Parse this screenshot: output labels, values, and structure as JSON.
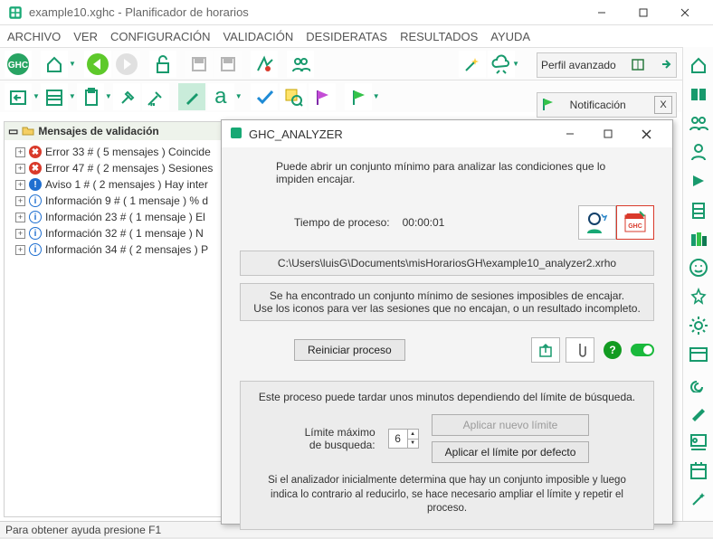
{
  "window": {
    "title": "example10.xghc - Planificador de horarios",
    "status": "Para obtener ayuda presione F1"
  },
  "menu": [
    "ARCHIVO",
    "VER",
    "CONFIGURACIÓN",
    "VALIDACIÓN",
    "DESIDERATAS",
    "RESULTADOS",
    "AYUDA"
  ],
  "profile": {
    "label": "Perfil avanzado"
  },
  "notification": {
    "label": "Notificación",
    "close": "X"
  },
  "tree": {
    "header": "Mensajes de validación",
    "items": [
      {
        "kind": "err",
        "text": "Error 33 # ( 5 mensajes )  Coincide"
      },
      {
        "kind": "err",
        "text": "Error 47 # ( 2 mensajes )  Sesiones"
      },
      {
        "kind": "warn",
        "text": "Aviso 1 # ( 2 mensajes )  Hay inter"
      },
      {
        "kind": "info",
        "text": "Información 9 # ( 1 mensaje )   % d"
      },
      {
        "kind": "info",
        "text": "Información 23 # ( 1 mensaje )   El"
      },
      {
        "kind": "info",
        "text": "Información 32 # ( 1 mensaje )   N"
      },
      {
        "kind": "info",
        "text": "Información 34 # ( 2 mensajes )  P"
      }
    ]
  },
  "dialog": {
    "title": "GHC_ANALYZER",
    "intro": "Puede abrir un conjunto mínimo para analizar las condiciones que lo impiden encajar.",
    "time_label": "Tiempo de proceso:",
    "time_value": "00:00:01",
    "path": "C:\\Users\\luisG\\Documents\\misHorariosGH\\example10_analyzer2.xrho",
    "msg1": "Se ha encontrado un conjunto mínimo de sesiones imposibles de encajar.",
    "msg2": "Use los iconos para ver las sesiones que no encajan, o un resultado incompleto.",
    "restart": "Reiniciar proceso",
    "limit_intro": "Este proceso puede tardar unos minutos dependiendo del límite de búsqueda.",
    "limit_label1": "Límite máximo",
    "limit_label2": "de busqueda:",
    "limit_value": "6",
    "apply_new": "Aplicar nuevo límite",
    "apply_default": "Aplicar el límite por defecto",
    "footnote": "Si el analizador inicialmente determina que hay un conjunto imposible y luego indica lo contrario al reducirlo, se hace necesario ampliar el límite y repetir el proceso."
  }
}
